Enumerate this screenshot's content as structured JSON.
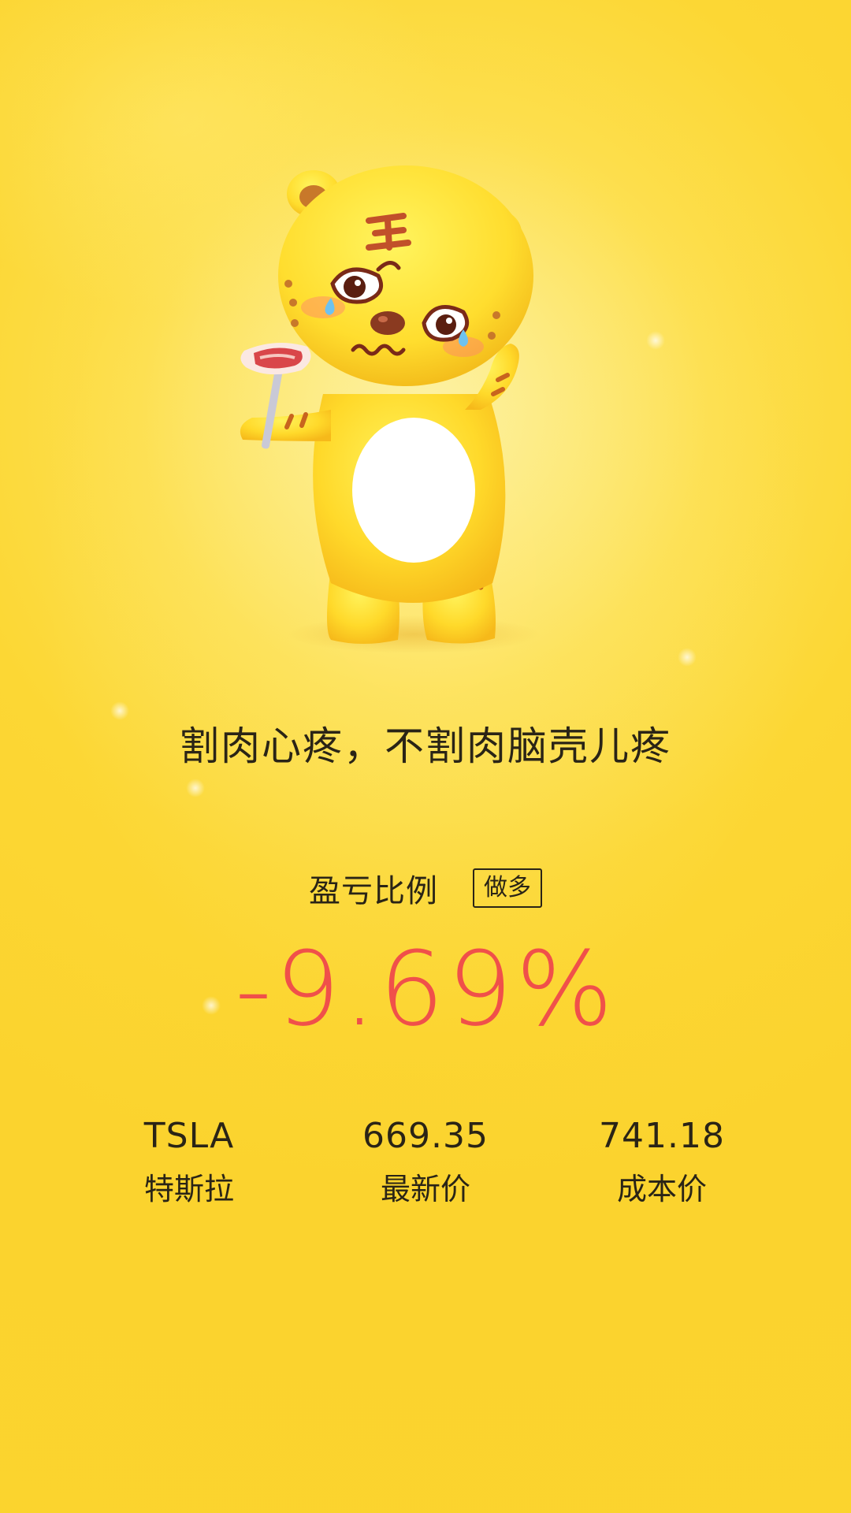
{
  "slogan": "割肉心疼，不割肉脑壳儿疼",
  "ratio": {
    "label": "盈亏比例",
    "direction": "做多",
    "value": "-9.69%"
  },
  "stats": [
    {
      "value": "TSLA",
      "label": "特斯拉"
    },
    {
      "value": "669.35",
      "label": "最新价"
    },
    {
      "value": "741.18",
      "label": "成本价"
    }
  ],
  "colors": {
    "background": "#fbd42d",
    "text": "#2a2416",
    "loss": "#f0504a"
  },
  "icons": {
    "mascot": "tiger-mascot-holding-meat-icon"
  }
}
